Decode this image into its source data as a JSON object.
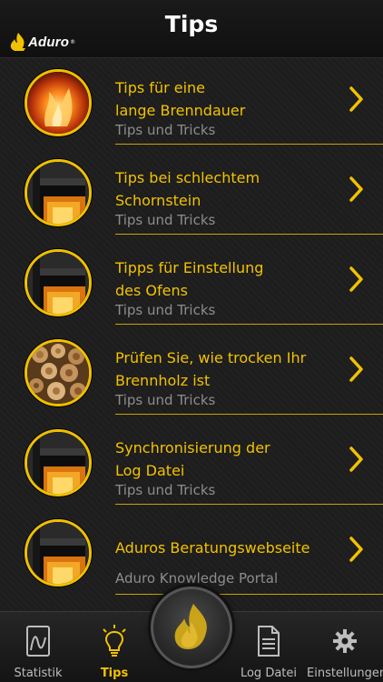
{
  "header": {
    "title": "Tips",
    "logo_text": "Aduro",
    "logo_mark": "®"
  },
  "colors": {
    "accent": "#f2c200",
    "subtitle": "#8d8d8d",
    "background": "#1d1d1d"
  },
  "tips": [
    {
      "title_line1": "Tips für eine",
      "title_line2": "lange Brenndauer",
      "subtitle": "Tips und Tricks",
      "image": "flame-photo"
    },
    {
      "title_line1": "Tips bei schlechtem",
      "title_line2": "Schornstein",
      "subtitle": "Tips und Tricks",
      "image": "stove-photo"
    },
    {
      "title_line1": "Tipps für Einstellung",
      "title_line2": "des Ofens",
      "subtitle": "Tips und Tricks",
      "image": "stove-photo"
    },
    {
      "title_line1": "Prüfen Sie, wie trocken Ihr",
      "title_line2": "Brennholz ist",
      "subtitle": "Tips und Tricks",
      "image": "firewood-photo"
    },
    {
      "title_line1": "Synchronisierung der",
      "title_line2": "Log Datei",
      "subtitle": "Tips und Tricks",
      "image": "stove-photo"
    },
    {
      "title_line1": "Aduros Beratungswebseite",
      "title_line2": "",
      "subtitle": "Aduro Knowledge Portal",
      "image": "stove-photo"
    }
  ],
  "tabs": [
    {
      "label": "Statistik",
      "icon": "chart-document-icon",
      "active": false
    },
    {
      "label": "Tips",
      "icon": "lightbulb-icon",
      "active": true
    },
    {
      "label": "",
      "icon": "flame-icon",
      "active": false
    },
    {
      "label": "Log Datei",
      "icon": "document-icon",
      "active": false
    },
    {
      "label": "Einstellungen",
      "icon": "gear-icon",
      "active": false
    }
  ]
}
